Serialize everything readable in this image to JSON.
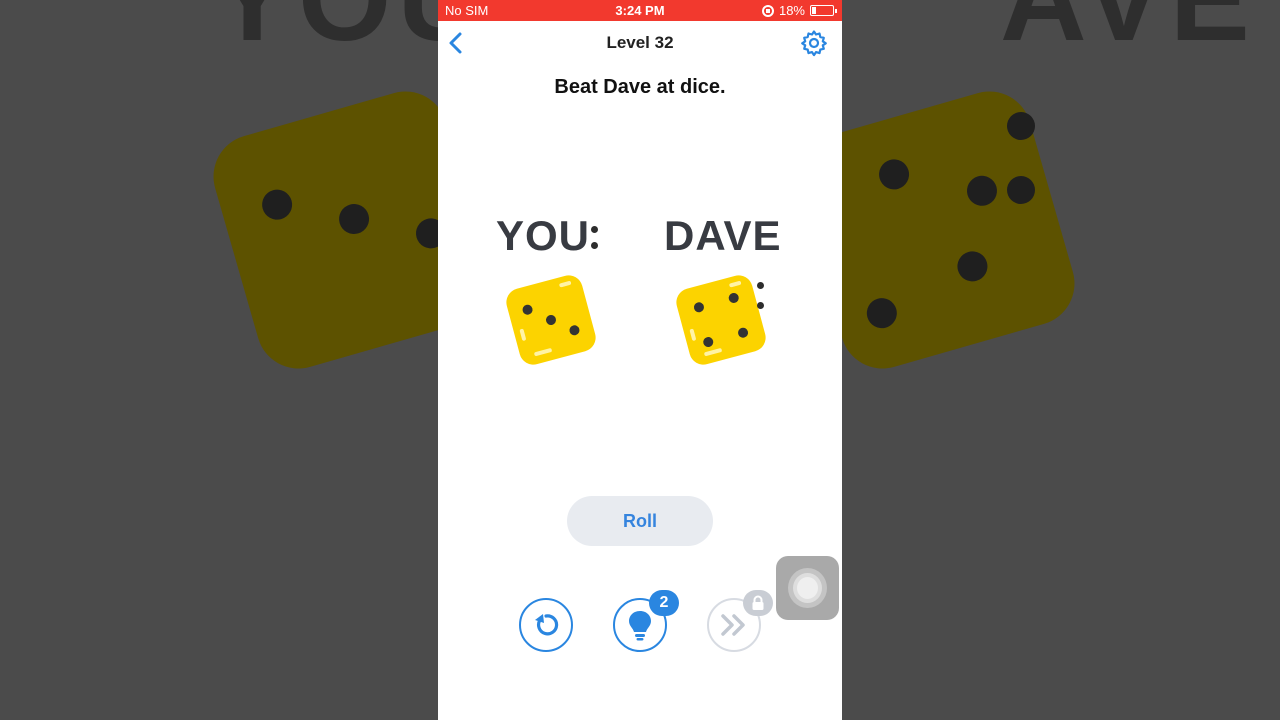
{
  "status_bar": {
    "carrier": "No SIM",
    "time": "3:24 PM",
    "battery": "18%"
  },
  "nav": {
    "title": "Level 32",
    "back_icon": "chevron-left-icon",
    "settings_icon": "gear-icon"
  },
  "level": {
    "prompt": "Beat Dave at dice."
  },
  "players": {
    "you_label": "YOU",
    "dave_label": "DAVE",
    "you_die_value": 3,
    "dave_die_value": 4
  },
  "buttons": {
    "roll_label": "Roll",
    "restart_icon": "restart-icon",
    "hint_icon": "lightbulb-icon",
    "hint_count": "2",
    "skip_icon": "skip-forward-icon",
    "skip_locked_icon": "lock-icon"
  },
  "background": {
    "text_left": "YOU",
    "text_right": "AVE"
  },
  "colors": {
    "accent": "#2a86e0",
    "status_bar": "#f2392e",
    "die": "#fcd300",
    "roll_bg": "#e8ebf0"
  }
}
